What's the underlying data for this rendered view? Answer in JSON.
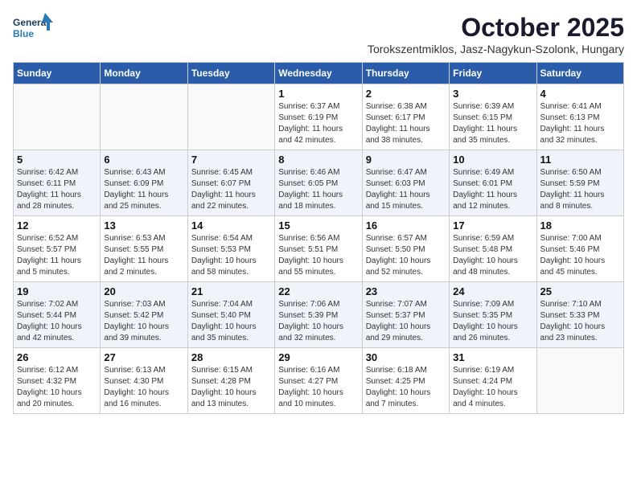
{
  "header": {
    "logo_line1": "General",
    "logo_line2": "Blue",
    "title": "October 2025",
    "subtitle": "Torokszentmiklos, Jasz-Nagykun-Szolonk, Hungary"
  },
  "weekdays": [
    "Sunday",
    "Monday",
    "Tuesday",
    "Wednesday",
    "Thursday",
    "Friday",
    "Saturday"
  ],
  "weeks": [
    [
      {
        "day": "",
        "info": ""
      },
      {
        "day": "",
        "info": ""
      },
      {
        "day": "",
        "info": ""
      },
      {
        "day": "1",
        "info": "Sunrise: 6:37 AM\nSunset: 6:19 PM\nDaylight: 11 hours\nand 42 minutes."
      },
      {
        "day": "2",
        "info": "Sunrise: 6:38 AM\nSunset: 6:17 PM\nDaylight: 11 hours\nand 38 minutes."
      },
      {
        "day": "3",
        "info": "Sunrise: 6:39 AM\nSunset: 6:15 PM\nDaylight: 11 hours\nand 35 minutes."
      },
      {
        "day": "4",
        "info": "Sunrise: 6:41 AM\nSunset: 6:13 PM\nDaylight: 11 hours\nand 32 minutes."
      }
    ],
    [
      {
        "day": "5",
        "info": "Sunrise: 6:42 AM\nSunset: 6:11 PM\nDaylight: 11 hours\nand 28 minutes."
      },
      {
        "day": "6",
        "info": "Sunrise: 6:43 AM\nSunset: 6:09 PM\nDaylight: 11 hours\nand 25 minutes."
      },
      {
        "day": "7",
        "info": "Sunrise: 6:45 AM\nSunset: 6:07 PM\nDaylight: 11 hours\nand 22 minutes."
      },
      {
        "day": "8",
        "info": "Sunrise: 6:46 AM\nSunset: 6:05 PM\nDaylight: 11 hours\nand 18 minutes."
      },
      {
        "day": "9",
        "info": "Sunrise: 6:47 AM\nSunset: 6:03 PM\nDaylight: 11 hours\nand 15 minutes."
      },
      {
        "day": "10",
        "info": "Sunrise: 6:49 AM\nSunset: 6:01 PM\nDaylight: 11 hours\nand 12 minutes."
      },
      {
        "day": "11",
        "info": "Sunrise: 6:50 AM\nSunset: 5:59 PM\nDaylight: 11 hours\nand 8 minutes."
      }
    ],
    [
      {
        "day": "12",
        "info": "Sunrise: 6:52 AM\nSunset: 5:57 PM\nDaylight: 11 hours\nand 5 minutes."
      },
      {
        "day": "13",
        "info": "Sunrise: 6:53 AM\nSunset: 5:55 PM\nDaylight: 11 hours\nand 2 minutes."
      },
      {
        "day": "14",
        "info": "Sunrise: 6:54 AM\nSunset: 5:53 PM\nDaylight: 10 hours\nand 58 minutes."
      },
      {
        "day": "15",
        "info": "Sunrise: 6:56 AM\nSunset: 5:51 PM\nDaylight: 10 hours\nand 55 minutes."
      },
      {
        "day": "16",
        "info": "Sunrise: 6:57 AM\nSunset: 5:50 PM\nDaylight: 10 hours\nand 52 minutes."
      },
      {
        "day": "17",
        "info": "Sunrise: 6:59 AM\nSunset: 5:48 PM\nDaylight: 10 hours\nand 48 minutes."
      },
      {
        "day": "18",
        "info": "Sunrise: 7:00 AM\nSunset: 5:46 PM\nDaylight: 10 hours\nand 45 minutes."
      }
    ],
    [
      {
        "day": "19",
        "info": "Sunrise: 7:02 AM\nSunset: 5:44 PM\nDaylight: 10 hours\nand 42 minutes."
      },
      {
        "day": "20",
        "info": "Sunrise: 7:03 AM\nSunset: 5:42 PM\nDaylight: 10 hours\nand 39 minutes."
      },
      {
        "day": "21",
        "info": "Sunrise: 7:04 AM\nSunset: 5:40 PM\nDaylight: 10 hours\nand 35 minutes."
      },
      {
        "day": "22",
        "info": "Sunrise: 7:06 AM\nSunset: 5:39 PM\nDaylight: 10 hours\nand 32 minutes."
      },
      {
        "day": "23",
        "info": "Sunrise: 7:07 AM\nSunset: 5:37 PM\nDaylight: 10 hours\nand 29 minutes."
      },
      {
        "day": "24",
        "info": "Sunrise: 7:09 AM\nSunset: 5:35 PM\nDaylight: 10 hours\nand 26 minutes."
      },
      {
        "day": "25",
        "info": "Sunrise: 7:10 AM\nSunset: 5:33 PM\nDaylight: 10 hours\nand 23 minutes."
      }
    ],
    [
      {
        "day": "26",
        "info": "Sunrise: 6:12 AM\nSunset: 4:32 PM\nDaylight: 10 hours\nand 20 minutes."
      },
      {
        "day": "27",
        "info": "Sunrise: 6:13 AM\nSunset: 4:30 PM\nDaylight: 10 hours\nand 16 minutes."
      },
      {
        "day": "28",
        "info": "Sunrise: 6:15 AM\nSunset: 4:28 PM\nDaylight: 10 hours\nand 13 minutes."
      },
      {
        "day": "29",
        "info": "Sunrise: 6:16 AM\nSunset: 4:27 PM\nDaylight: 10 hours\nand 10 minutes."
      },
      {
        "day": "30",
        "info": "Sunrise: 6:18 AM\nSunset: 4:25 PM\nDaylight: 10 hours\nand 7 minutes."
      },
      {
        "day": "31",
        "info": "Sunrise: 6:19 AM\nSunset: 4:24 PM\nDaylight: 10 hours\nand 4 minutes."
      },
      {
        "day": "",
        "info": ""
      }
    ]
  ]
}
